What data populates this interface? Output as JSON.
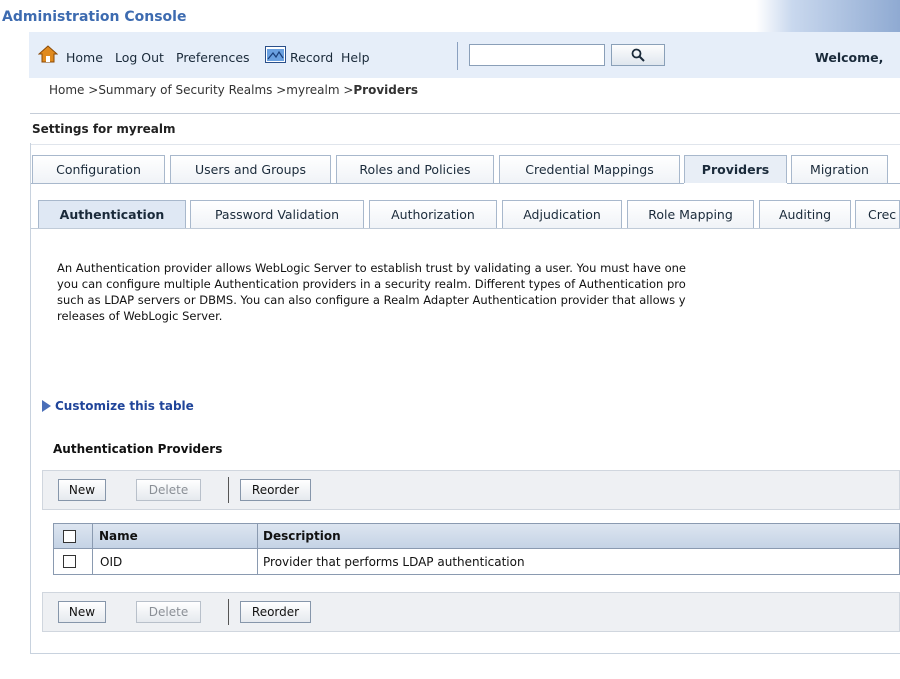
{
  "console_title": "Administration Console",
  "toolbar": {
    "home": "Home",
    "logout": "Log Out",
    "preferences": "Preferences",
    "record": "Record",
    "help": "Help",
    "search_value": "",
    "welcome": "Welcome,"
  },
  "breadcrumb": {
    "home": "Home >",
    "summary": "Summary of Security Realms >",
    "realm": "myrealm >",
    "current": "Providers"
  },
  "settings_title": "Settings for myrealm",
  "tabs": [
    {
      "label": "Configuration"
    },
    {
      "label": "Users and Groups"
    },
    {
      "label": "Roles and Policies"
    },
    {
      "label": "Credential Mappings"
    },
    {
      "label": "Providers"
    },
    {
      "label": "Migration"
    }
  ],
  "subtabs": [
    {
      "label": "Authentication"
    },
    {
      "label": "Password Validation"
    },
    {
      "label": "Authorization"
    },
    {
      "label": "Adjudication"
    },
    {
      "label": "Role Mapping"
    },
    {
      "label": "Auditing"
    },
    {
      "label": "Crec"
    }
  ],
  "description": [
    "An Authentication provider allows WebLogic Server to establish trust by validating a user. You must have one",
    "you can configure multiple Authentication providers in a security realm. Different types of Authentication pro",
    "such as LDAP servers or DBMS. You can also configure a Realm Adapter Authentication provider that allows y",
    "releases of WebLogic Server."
  ],
  "customize_link": "Customize this table",
  "section_title": "Authentication Providers",
  "buttons": {
    "new": "New",
    "delete": "Delete",
    "reorder": "Reorder"
  },
  "table": {
    "columns": [
      "Name",
      "Description"
    ],
    "rows": [
      {
        "name": "OID",
        "description": "Provider that performs LDAP authentication"
      }
    ]
  },
  "colors": {
    "accent": "#3d6bb0",
    "toolbar_bg": "#e6eef9",
    "link_visited": "#6a2a8a"
  }
}
